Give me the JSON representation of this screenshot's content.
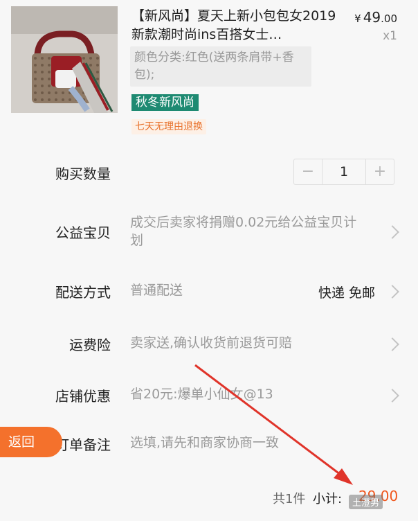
{
  "product": {
    "title": "【新风尚】夏天上新小包包女2019新款潮时尚ins百搭女士…",
    "price_currency": "¥",
    "price_int": "49",
    "price_cents": ".00",
    "quantity_label": "x1",
    "variant": "颜色分类:红色(送两条肩带+香包);",
    "tag_season": "秋冬新风尚",
    "tag_return": "七天无理由退换"
  },
  "quantity": {
    "label": "购买数量",
    "minus": "−",
    "value": "1",
    "plus": "+"
  },
  "charity": {
    "label": "公益宝贝",
    "text": "成交后卖家将捐赠0.02元给公益宝贝计划"
  },
  "shipping": {
    "label": "配送方式",
    "method": "普通配送",
    "detail": "快递 免邮"
  },
  "insurance": {
    "label": "运费险",
    "text": "卖家送,确认收货前退货可赔"
  },
  "coupon": {
    "label": "店铺优惠",
    "text": "省20元:爆单小仙女@13"
  },
  "note": {
    "label": "订单备注",
    "placeholder": "选填,请先和商家协商一致"
  },
  "back_button": "返回",
  "footer": {
    "count": "共1件",
    "subtotal_label": "小计:",
    "subtotal_value": "29.00"
  },
  "watermark": "土澄男",
  "colors": {
    "accent": "#f0561c",
    "season_tag": "#1e8a72",
    "back_button": "#f4712c",
    "arrow": "#e0342a"
  }
}
